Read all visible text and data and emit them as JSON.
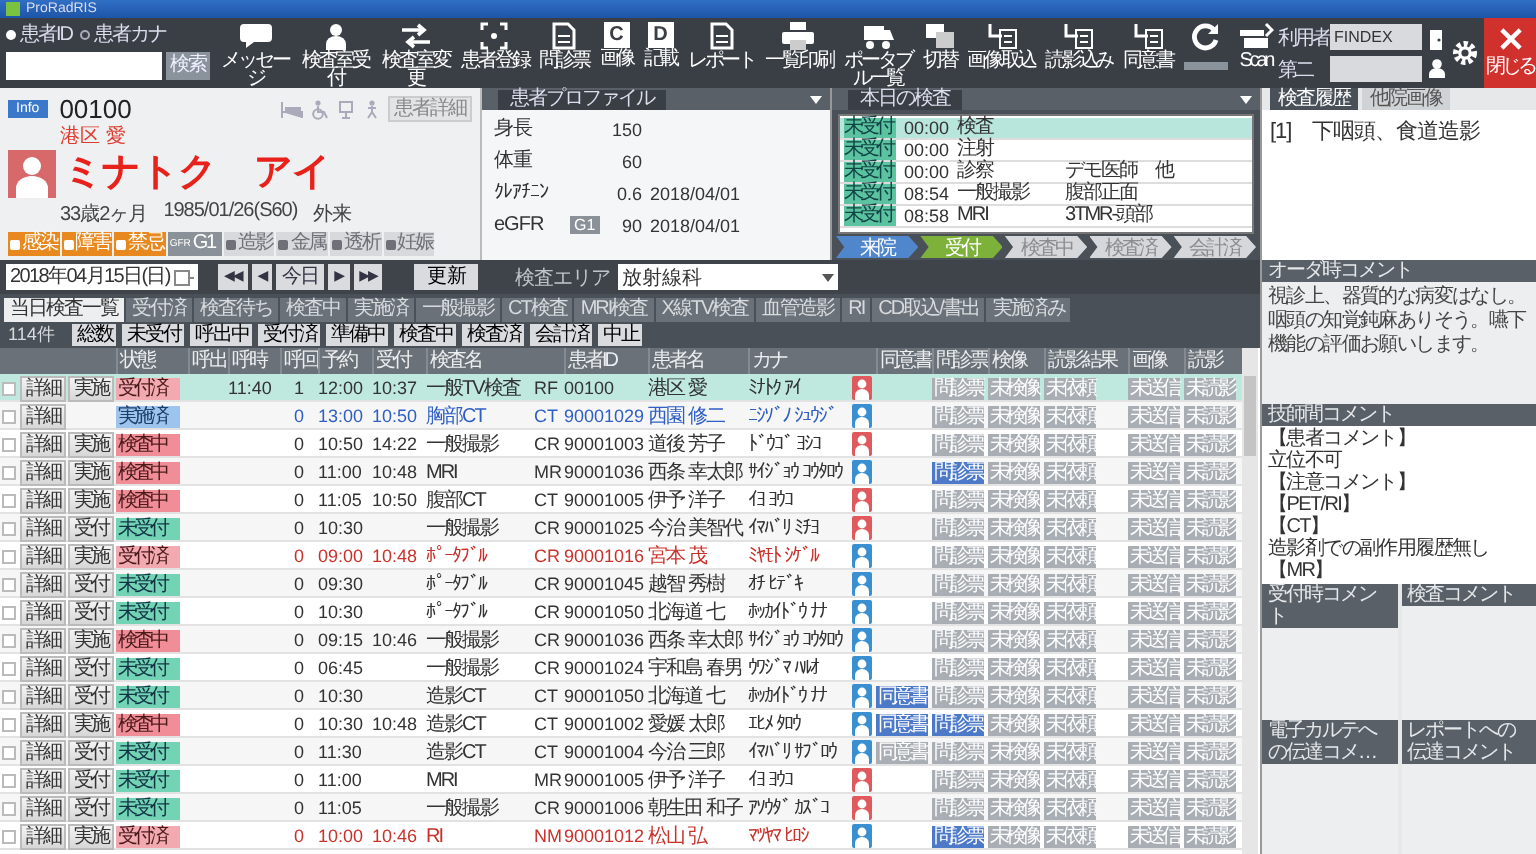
{
  "window": {
    "title": "ProRadRIS"
  },
  "toolbar": {
    "search_modes": [
      {
        "label": "患者ID",
        "selected": true
      },
      {
        "label": "患者カナ",
        "selected": false
      }
    ],
    "search_button": "検索",
    "buttons": [
      {
        "label": "メッセージ"
      },
      {
        "label": "検査室受付"
      },
      {
        "label": "検査室変更"
      },
      {
        "label": "患者登録"
      },
      {
        "label": "問診票"
      },
      {
        "label": "画像",
        "glyph": "C"
      },
      {
        "label": "記載",
        "glyph": "D"
      },
      {
        "label": "レポート"
      },
      {
        "label": "一覧印刷"
      },
      {
        "label": "ポータブル一覧"
      },
      {
        "label": "切替"
      },
      {
        "label": "画像取込"
      },
      {
        "label": "読影込み"
      },
      {
        "label": "同意書"
      },
      {
        "label": "Scan"
      }
    ],
    "user": {
      "label": "利用者",
      "name": "FINDEX",
      "sub_label": "第二"
    },
    "close": "閉じる"
  },
  "patient": {
    "badge": "Info",
    "id": "00100",
    "name": "港区 愛",
    "kana": "ミナトク　アイ",
    "female": true,
    "age": "33歳2ヶ月",
    "birth": "1985/01/26(S60)",
    "visit": "外来",
    "detail_button": "患者詳細",
    "flags": [
      {
        "label": "感染",
        "active": true,
        "kind": "flag"
      },
      {
        "label": "障害",
        "active": true,
        "kind": "flag"
      },
      {
        "label": "禁忌",
        "active": true,
        "kind": "flag"
      },
      {
        "label": "G1",
        "caption": "GFR",
        "active": true,
        "kind": "grade"
      },
      {
        "label": "造影",
        "active": false,
        "kind": "flag"
      },
      {
        "label": "金属",
        "active": false,
        "kind": "flag"
      },
      {
        "label": "透析",
        "active": false,
        "kind": "flag"
      },
      {
        "label": "妊娠",
        "active": false,
        "kind": "flag"
      }
    ]
  },
  "profile": {
    "title": "患者プロファイル",
    "rows": [
      {
        "label": "身長",
        "value": "150"
      },
      {
        "label": "体重",
        "value": "60"
      },
      {
        "label": "ｸﾚｱﾁﾆﾝ",
        "value": "0.6",
        "date": "2018/04/01"
      },
      {
        "label": "eGFR",
        "grade": "G1",
        "value": "90",
        "date": "2018/04/01"
      }
    ]
  },
  "today": {
    "title": "本日の検査",
    "rows": [
      {
        "status": "未受付",
        "time": "00:00",
        "exam": "検査",
        "selected": true
      },
      {
        "status": "未受付",
        "time": "00:00",
        "exam": "注射",
        "selected": false
      },
      {
        "status": "未受付",
        "time": "00:00",
        "exam": "診察",
        "doctor": "デモ医師　他",
        "selected": false
      },
      {
        "status": "未受付",
        "time": "08:54",
        "exam": "一般撮影",
        "doctor": "腹部正面",
        "selected": false
      },
      {
        "status": "未受付",
        "time": "08:58",
        "exam": "MRI",
        "doctor": "3TMR-頭部",
        "selected": false
      }
    ],
    "flow": [
      {
        "label": "来院",
        "kind": "done"
      },
      {
        "label": "受付",
        "kind": "current"
      },
      {
        "label": "検査中",
        "kind": "pending"
      },
      {
        "label": "検査済",
        "kind": "pending"
      },
      {
        "label": "会計済",
        "kind": "pending"
      }
    ]
  },
  "history": {
    "tabs": [
      {
        "label": "検査履歴",
        "selected": true
      },
      {
        "label": "他院画像",
        "selected": false
      }
    ],
    "items": [
      "[1]　下咽頭、食道造影"
    ]
  },
  "order_comment": {
    "title": "オーダ時コメント",
    "text": "視診上、器質的な病変はなし。咽頭の知覚鈍麻ありそう。嚥下機能の評価お願いします。"
  },
  "tech_comment": {
    "title": "技師間コメント",
    "lines": [
      "【患者コメント】",
      "立位不可",
      "【注意コメント】",
      "【PET/RI】",
      "【CT】",
      "造影剤での副作用履歴無し",
      "【MR】"
    ]
  },
  "comment_panels": [
    {
      "title": "受付時コメント"
    },
    {
      "title": "検査コメント"
    },
    {
      "title": "電子カルテへの伝達コメ…"
    },
    {
      "title": "レポートへの伝達コメント"
    }
  ],
  "datebar": {
    "date": "2018年04月15日(日)",
    "nav": [
      "◀◀",
      "◀",
      "今日",
      "▶",
      "▶▶"
    ],
    "refresh": "更新",
    "area_label": "検査エリア",
    "area": "放射線科"
  },
  "tabs": [
    {
      "label": "当日検査一覧",
      "selected": true
    },
    {
      "label": "受付済",
      "selected": false
    },
    {
      "label": "検査待ち",
      "selected": false
    },
    {
      "label": "検査中",
      "selected": false
    },
    {
      "label": "実施済",
      "selected": false
    },
    {
      "label": "一般撮影",
      "selected": false
    },
    {
      "label": "CT検査",
      "selected": false
    },
    {
      "label": "MRI検査",
      "selected": false
    },
    {
      "label": "X線TV検査",
      "selected": false
    },
    {
      "label": "血管造影",
      "selected": false
    },
    {
      "label": "RI",
      "selected": false
    },
    {
      "label": "CD取込/書出",
      "selected": false
    },
    {
      "label": "実施済み",
      "selected": false
    }
  ],
  "filters": {
    "count": "114件",
    "buttons": [
      "総数",
      "未受付",
      "呼出中",
      "受付済",
      "準備中",
      "検査中",
      "検査済",
      "会計済",
      "中止"
    ]
  },
  "columns": {
    "status": "状態",
    "call": "呼出",
    "call_time": "呼時",
    "calls": "呼回",
    "reserved": "予約",
    "received": "受付",
    "exam": "検査名",
    "patient_id": "患者ID",
    "name": "患者名",
    "kana": "カナ",
    "consent": "同意書",
    "doc_1": "問診票",
    "doc_2": "検像",
    "doc_3": "読影結果",
    "doc_4": "画像",
    "doc_5": "読影"
  },
  "rows": [
    {
      "selected": true,
      "checked": false,
      "detail": "詳細",
      "action": "実施",
      "status": "受付済",
      "kind": "received",
      "call_time": "11:40",
      "calls": "1",
      "reserved": "12:00",
      "received": "10:37",
      "exam": "一般TV検査",
      "modality": "RF",
      "patient_id": "00100",
      "name": "港区 愛",
      "kana": "ﾐﾅﾄｸ ｱｲ",
      "female": true,
      "docs": [
        {
          "label": "問診票",
          "done": false
        },
        {
          "label": "未検像",
          "done": false
        },
        {
          "label": "未依頼",
          "done": false
        },
        {
          "label": "未送信",
          "done": false
        },
        {
          "label": "未読影",
          "done": false
        }
      ]
    },
    {
      "selected": false,
      "checked": false,
      "detail": "詳細",
      "status": "実施済",
      "kind": "done",
      "calls": "0",
      "reserved": "13:00",
      "received": "10:50",
      "exam": "胸部CT",
      "modality": "CT",
      "patient_id": "90001029",
      "name": "西園 修二",
      "kana": "ﾆｼｿﾞﾉ ｼｭｳｼﾞ",
      "female": false,
      "docs": [
        {
          "label": "問診票",
          "done": false
        },
        {
          "label": "未検像",
          "done": false
        },
        {
          "label": "未依頼",
          "done": false
        },
        {
          "label": "未送信",
          "done": false
        },
        {
          "label": "未読影",
          "done": false
        }
      ]
    },
    {
      "selected": false,
      "checked": false,
      "detail": "詳細",
      "action": "実施",
      "status": "検査中",
      "kind": "in_progress",
      "calls": "0",
      "reserved": "10:50",
      "received": "14:22",
      "exam": "一般撮影",
      "modality": "CR",
      "patient_id": "90001003",
      "name": "道後 芳子",
      "kana": "ﾄﾞｳｺﾞ ﾖｼｺ",
      "female": true,
      "docs": [
        {
          "label": "問診票",
          "done": false
        },
        {
          "label": "未検像",
          "done": false
        },
        {
          "label": "未依頼",
          "done": false
        },
        {
          "label": "未送信",
          "done": false
        },
        {
          "label": "未読影",
          "done": false
        }
      ]
    },
    {
      "selected": false,
      "checked": false,
      "detail": "詳細",
      "action": "実施",
      "status": "検査中",
      "kind": "in_progress",
      "calls": "0",
      "reserved": "11:00",
      "received": "10:48",
      "exam": "MRI",
      "modality": "MR",
      "patient_id": "90001036",
      "name": "西条 幸太郎",
      "kana": "ｻｲｼﾞｮｳ ｺｳﾀﾛｳ",
      "female": false,
      "docs": [
        {
          "label": "問診票",
          "done": true
        },
        {
          "label": "未検像",
          "done": false
        },
        {
          "label": "未依頼",
          "done": false
        },
        {
          "label": "未送信",
          "done": false
        },
        {
          "label": "未読影",
          "done": false
        }
      ]
    },
    {
      "selected": false,
      "checked": false,
      "detail": "詳細",
      "action": "実施",
      "status": "検査中",
      "kind": "in_progress",
      "calls": "0",
      "reserved": "11:05",
      "received": "10:50",
      "exam": "腹部CT",
      "modality": "CT",
      "patient_id": "90001005",
      "name": "伊予 洋子",
      "kana": "ｲﾖ ﾖｳｺ",
      "female": true,
      "docs": [
        {
          "label": "問診票",
          "done": false
        },
        {
          "label": "未検像",
          "done": false
        },
        {
          "label": "未依頼",
          "done": false
        },
        {
          "label": "未送信",
          "done": false
        },
        {
          "label": "未読影",
          "done": false
        }
      ]
    },
    {
      "selected": false,
      "checked": false,
      "detail": "詳細",
      "action": "受付",
      "status": "未受付",
      "kind": "waiting",
      "calls": "0",
      "reserved": "10:30",
      "exam": "一般撮影",
      "modality": "CR",
      "patient_id": "90001025",
      "name": "今治 美智代",
      "kana": "ｲﾏﾊﾞﾘ ﾐﾁﾖ",
      "female": true,
      "docs": [
        {
          "label": "問診票",
          "done": false
        },
        {
          "label": "未検像",
          "done": false
        },
        {
          "label": "未依頼",
          "done": false
        },
        {
          "label": "未送信",
          "done": false
        },
        {
          "label": "未読影",
          "done": false
        }
      ]
    },
    {
      "selected": false,
      "checked": false,
      "detail": "詳細",
      "action": "実施",
      "status": "受付済",
      "kind": "received",
      "calls": "0",
      "reserved": "09:00",
      "received": "10:48",
      "exam": "ﾎﾟｰﾀﾌﾞﾙ",
      "modality": "CR",
      "patient_id": "90001016",
      "name": "宮本 茂",
      "kana": "ﾐﾔﾓﾄ ｼｹﾞﾙ",
      "female": false,
      "docs": [
        {
          "label": "問診票",
          "done": false
        },
        {
          "label": "未検像",
          "done": false
        },
        {
          "label": "未依頼",
          "done": false
        },
        {
          "label": "未送信",
          "done": false
        },
        {
          "label": "未読影",
          "done": false
        }
      ]
    },
    {
      "selected": false,
      "checked": false,
      "detail": "詳細",
      "action": "受付",
      "status": "未受付",
      "kind": "waiting",
      "calls": "0",
      "reserved": "09:30",
      "exam": "ﾎﾟｰﾀﾌﾞﾙ",
      "modality": "CR",
      "patient_id": "90001045",
      "name": "越智 秀樹",
      "kana": "ｵﾁ ﾋﾃﾞｷ",
      "female": false,
      "docs": [
        {
          "label": "問診票",
          "done": false
        },
        {
          "label": "未検像",
          "done": false
        },
        {
          "label": "未依頼",
          "done": false
        },
        {
          "label": "未送信",
          "done": false
        },
        {
          "label": "未読影",
          "done": false
        }
      ]
    },
    {
      "selected": false,
      "checked": false,
      "detail": "詳細",
      "action": "受付",
      "status": "未受付",
      "kind": "waiting",
      "calls": "0",
      "reserved": "10:30",
      "exam": "ﾎﾟｰﾀﾌﾞﾙ",
      "modality": "CR",
      "patient_id": "90001050",
      "name": "北海道 七",
      "kana": "ﾎｯｶｲﾄﾞｳ ﾅﾅ",
      "female": false,
      "docs": [
        {
          "label": "問診票",
          "done": false
        },
        {
          "label": "未検像",
          "done": false
        },
        {
          "label": "未依頼",
          "done": false
        },
        {
          "label": "未送信",
          "done": false
        },
        {
          "label": "未読影",
          "done": false
        }
      ]
    },
    {
      "selected": false,
      "checked": false,
      "detail": "詳細",
      "action": "実施",
      "status": "検査中",
      "kind": "in_progress",
      "calls": "0",
      "reserved": "09:15",
      "received": "10:46",
      "exam": "一般撮影",
      "modality": "CR",
      "patient_id": "90001036",
      "name": "西条 幸太郎",
      "kana": "ｻｲｼﾞｮｳ ｺｳﾀﾛｳ",
      "female": false,
      "docs": [
        {
          "label": "問診票",
          "done": false
        },
        {
          "label": "未検像",
          "done": false
        },
        {
          "label": "未依頼",
          "done": false
        },
        {
          "label": "未送信",
          "done": false
        },
        {
          "label": "未読影",
          "done": false
        }
      ]
    },
    {
      "selected": false,
      "checked": false,
      "detail": "詳細",
      "action": "受付",
      "status": "未受付",
      "kind": "waiting",
      "calls": "0",
      "reserved": "06:45",
      "exam": "一般撮影",
      "modality": "CR",
      "patient_id": "90001024",
      "name": "宇和島 春男",
      "kana": "ｳﾜｼﾞﾏ ﾊﾙｵ",
      "female": false,
      "docs": [
        {
          "label": "問診票",
          "done": false
        },
        {
          "label": "未検像",
          "done": false
        },
        {
          "label": "未依頼",
          "done": false
        },
        {
          "label": "未送信",
          "done": false
        },
        {
          "label": "未読影",
          "done": false
        }
      ]
    },
    {
      "selected": false,
      "checked": false,
      "detail": "詳細",
      "action": "受付",
      "status": "未受付",
      "kind": "waiting",
      "calls": "0",
      "reserved": "10:30",
      "exam": "造影CT",
      "modality": "CT",
      "patient_id": "90001050",
      "name": "北海道 七",
      "kana": "ﾎｯｶｲﾄﾞｳ ﾅﾅ",
      "female": false,
      "consent": {
        "label": "同意書",
        "done": true
      },
      "docs": [
        {
          "label": "問診票",
          "done": false
        },
        {
          "label": "未検像",
          "done": false
        },
        {
          "label": "未依頼",
          "done": false
        },
        {
          "label": "未送信",
          "done": false
        },
        {
          "label": "未読影",
          "done": false
        }
      ]
    },
    {
      "selected": false,
      "checked": false,
      "detail": "詳細",
      "action": "実施",
      "status": "検査中",
      "kind": "in_progress",
      "calls": "0",
      "reserved": "10:30",
      "received": "10:48",
      "exam": "造影CT",
      "modality": "CT",
      "patient_id": "90001002",
      "name": "愛媛 太郎",
      "kana": "ｴﾋﾒ ﾀﾛｳ",
      "female": false,
      "consent": {
        "label": "同意書",
        "done": true
      },
      "docs": [
        {
          "label": "問診票",
          "done": true
        },
        {
          "label": "未検像",
          "done": false
        },
        {
          "label": "未依頼",
          "done": false
        },
        {
          "label": "未送信",
          "done": false
        },
        {
          "label": "未読影",
          "done": false
        }
      ]
    },
    {
      "selected": false,
      "checked": false,
      "detail": "詳細",
      "action": "受付",
      "status": "未受付",
      "kind": "waiting",
      "calls": "0",
      "reserved": "11:30",
      "exam": "造影CT",
      "modality": "CT",
      "patient_id": "90001004",
      "name": "今治 三郎",
      "kana": "ｲﾏﾊﾞﾘ ｻﾌﾞﾛｳ",
      "female": false,
      "consent": {
        "label": "同意書",
        "done": false
      },
      "docs": [
        {
          "label": "問診票",
          "done": false
        },
        {
          "label": "未検像",
          "done": false
        },
        {
          "label": "未依頼",
          "done": false
        },
        {
          "label": "未送信",
          "done": false
        },
        {
          "label": "未読影",
          "done": false
        }
      ]
    },
    {
      "selected": false,
      "checked": false,
      "detail": "詳細",
      "action": "受付",
      "status": "未受付",
      "kind": "waiting",
      "calls": "0",
      "reserved": "11:00",
      "exam": "MRI",
      "modality": "MR",
      "patient_id": "90001005",
      "name": "伊予 洋子",
      "kana": "ｲﾖ ﾖｳｺ",
      "female": true,
      "docs": [
        {
          "label": "問診票",
          "done": false
        },
        {
          "label": "未検像",
          "done": false
        },
        {
          "label": "未依頼",
          "done": false
        },
        {
          "label": "未送信",
          "done": false
        },
        {
          "label": "未読影",
          "done": false
        }
      ]
    },
    {
      "selected": false,
      "checked": false,
      "detail": "詳細",
      "action": "受付",
      "status": "未受付",
      "kind": "waiting",
      "calls": "0",
      "reserved": "11:05",
      "exam": "一般撮影",
      "modality": "CR",
      "patient_id": "90001006",
      "name": "朝生田 和子",
      "kana": "ｱｿｳﾀﾞ ｶｽﾞｺ",
      "female": true,
      "docs": [
        {
          "label": "問診票",
          "done": false
        },
        {
          "label": "未検像",
          "done": false
        },
        {
          "label": "未依頼",
          "done": false
        },
        {
          "label": "未送信",
          "done": false
        },
        {
          "label": "未読影",
          "done": false
        }
      ]
    },
    {
      "selected": false,
      "checked": false,
      "detail": "詳細",
      "action": "実施",
      "status": "受付済",
      "kind": "received",
      "calls": "0",
      "reserved": "10:00",
      "received": "10:46",
      "exam": "RI",
      "modality": "NM",
      "patient_id": "90001012",
      "name": "松山 弘",
      "kana": "ﾏﾂﾔﾏ ﾋﾛｼ",
      "female": false,
      "docs": [
        {
          "label": "問診票",
          "done": true
        },
        {
          "label": "未検像",
          "done": false
        },
        {
          "label": "未依頼",
          "done": false
        },
        {
          "label": "未送信",
          "done": false
        },
        {
          "label": "未読影",
          "done": false
        }
      ]
    }
  ]
}
